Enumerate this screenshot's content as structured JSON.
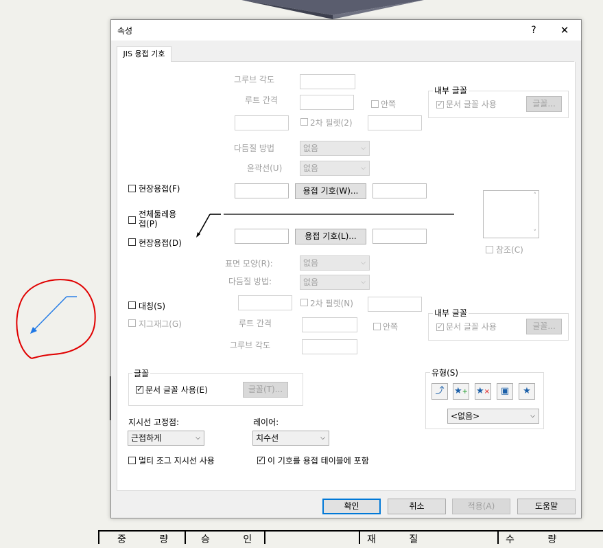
{
  "dialog": {
    "title": "속성",
    "help_label": "?",
    "close_label": "✕"
  },
  "tab": {
    "label": "JIS 용접 기호"
  },
  "upper": {
    "groove_angle_label": "그루브 각도",
    "root_gap_label": "루트 간격",
    "inside_label": "안쪽",
    "fillet2_label": "2차 필렛(2)",
    "multi_method_label": "다듬질 방법",
    "contour_label": "윤곽선(U)",
    "multi_method_value": "없음",
    "contour_value": "없음",
    "weld_symbol_btn": "용접 기호(W)..."
  },
  "checks": {
    "field_weld_f": "현장용접(F)",
    "all_around": "전체둘레용접(P)",
    "field_weld_d": "현장용접(D)",
    "symmetric": "대칭(S)",
    "zigzag": "지그재그(G)"
  },
  "lower": {
    "weld_symbol_btn": "용접 기호(L)...",
    "surface_label": "표면 모양(R):",
    "surface_value": "없음",
    "multi_method_label": "다듬질 방법:",
    "multi_method_value": "없음",
    "fillet2_label": "2차 필렛(N)",
    "root_gap_label": "루트 간격",
    "inside_label": "안쪽",
    "groove_angle_label": "그루브 각도"
  },
  "inner_font_top": {
    "title": "내부 글꼴",
    "use_doc_font": "문서 글꼴 사용",
    "font_btn": "글꼴..."
  },
  "inner_font_bottom": {
    "title": "내부 글꼴",
    "use_doc_font": "문서 글꼴 사용",
    "font_btn": "글꼴..."
  },
  "reference": {
    "label": "참조(C)"
  },
  "font_group": {
    "title": "글꼴",
    "use_doc_font": "문서 글꼴 사용(E)",
    "font_btn": "글꼴(T)..."
  },
  "style_group": {
    "title": "유형(S)",
    "select_value": "<없음>"
  },
  "leader": {
    "label": "지시선 고정점:",
    "value": "근접하게"
  },
  "layer": {
    "label": "레이어:",
    "value": "치수선"
  },
  "multi_jog": {
    "label": "멀티 조그 지시선 사용"
  },
  "include_table": {
    "label": "이 기호를 용접 테이블에 포함"
  },
  "footer": {
    "ok": "확인",
    "cancel": "취소",
    "apply": "적용(A)",
    "help": "도움말"
  },
  "background_table": {
    "c1": "중 량",
    "c2": "승 인",
    "c3": "재 질",
    "c4": "수 량"
  },
  "colors": {
    "accent": "#0078d7",
    "annotation_red": "#e00000",
    "arrow_blue": "#1e78e6"
  }
}
